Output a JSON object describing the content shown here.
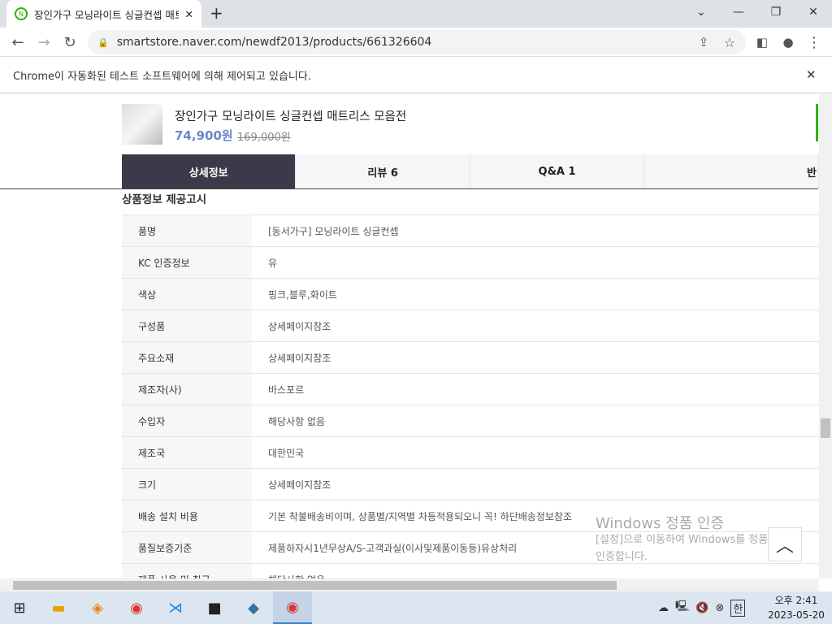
{
  "browser": {
    "tab_title": "장인가구 모닝라이트 싱글컨셉 매트리스 모음전",
    "url": "smartstore.naver.com/newdf2013/products/661326604",
    "infobar": "Chrome이 자동화된 테스트 소프트웨어에 의해 제어되고 있습니다."
  },
  "product": {
    "name": "장인가구 모닝라이트 싱글컨셉 매트리스 모음전",
    "price": "74,900원",
    "original_price": "169,000원"
  },
  "tabs": [
    "상세정보",
    "리뷰 6",
    "Q&A 1",
    "반"
  ],
  "table": {
    "title": "상품정보 제공고시",
    "rows": [
      {
        "k": "품명",
        "v": "[동서가구] 모닝라이트 싱글컨셉"
      },
      {
        "k": "KC 인증정보",
        "v": "유"
      },
      {
        "k": "색상",
        "v": "핑크,블루,화이트"
      },
      {
        "k": "구성품",
        "v": "상세페이지참조"
      },
      {
        "k": "주요소재",
        "v": "상세페이지참조"
      },
      {
        "k": "제조자(사)",
        "v": "바스포르"
      },
      {
        "k": "수입자",
        "v": "해당사항 없음"
      },
      {
        "k": "제조국",
        "v": "대한민국"
      },
      {
        "k": "크기",
        "v": "상세페이지참조"
      },
      {
        "k": "배송 설치 비용",
        "v": "기본 착불배송비이며, 상품별/지역별 차등적용되오니 꼭! 하단배송정보참조"
      },
      {
        "k": "품질보증기준",
        "v": "제품하자시1년무상A/S-고객과실(이사및제품이동등)유상처리"
      },
      {
        "k": "제품 사용 및 취급",
        "v": "해당사항 없음"
      }
    ]
  },
  "watermark": {
    "title": "Windows 정품 인증",
    "line1": "[설정]으로 이동하여 Windows를 정품",
    "line2": "인증합니다."
  },
  "tray": {
    "ime": "한",
    "time": "오후 2:41",
    "date": "2023-05-20"
  }
}
